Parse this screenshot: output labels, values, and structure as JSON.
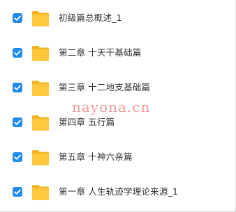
{
  "folders": [
    {
      "name": "初级篇总概述_1",
      "checked": true
    },
    {
      "name": "第二章 十天干基础篇",
      "checked": true
    },
    {
      "name": "第三章 十二地支基础篇",
      "checked": true
    },
    {
      "name": "第四章 五行篇",
      "checked": true
    },
    {
      "name": "第五章 十神六亲篇",
      "checked": true
    },
    {
      "name": "第一章 人生轨迹学理论来源_1",
      "checked": true
    }
  ],
  "watermark": "nayona.cn",
  "colors": {
    "checkbox": "#1f8ceb",
    "folder_body": "#ffc83d",
    "folder_back": "#f5b320",
    "text": "#333333",
    "watermark": "#e64646"
  },
  "icons": {
    "checkbox": "checkmark-icon",
    "folder": "folder-icon"
  }
}
